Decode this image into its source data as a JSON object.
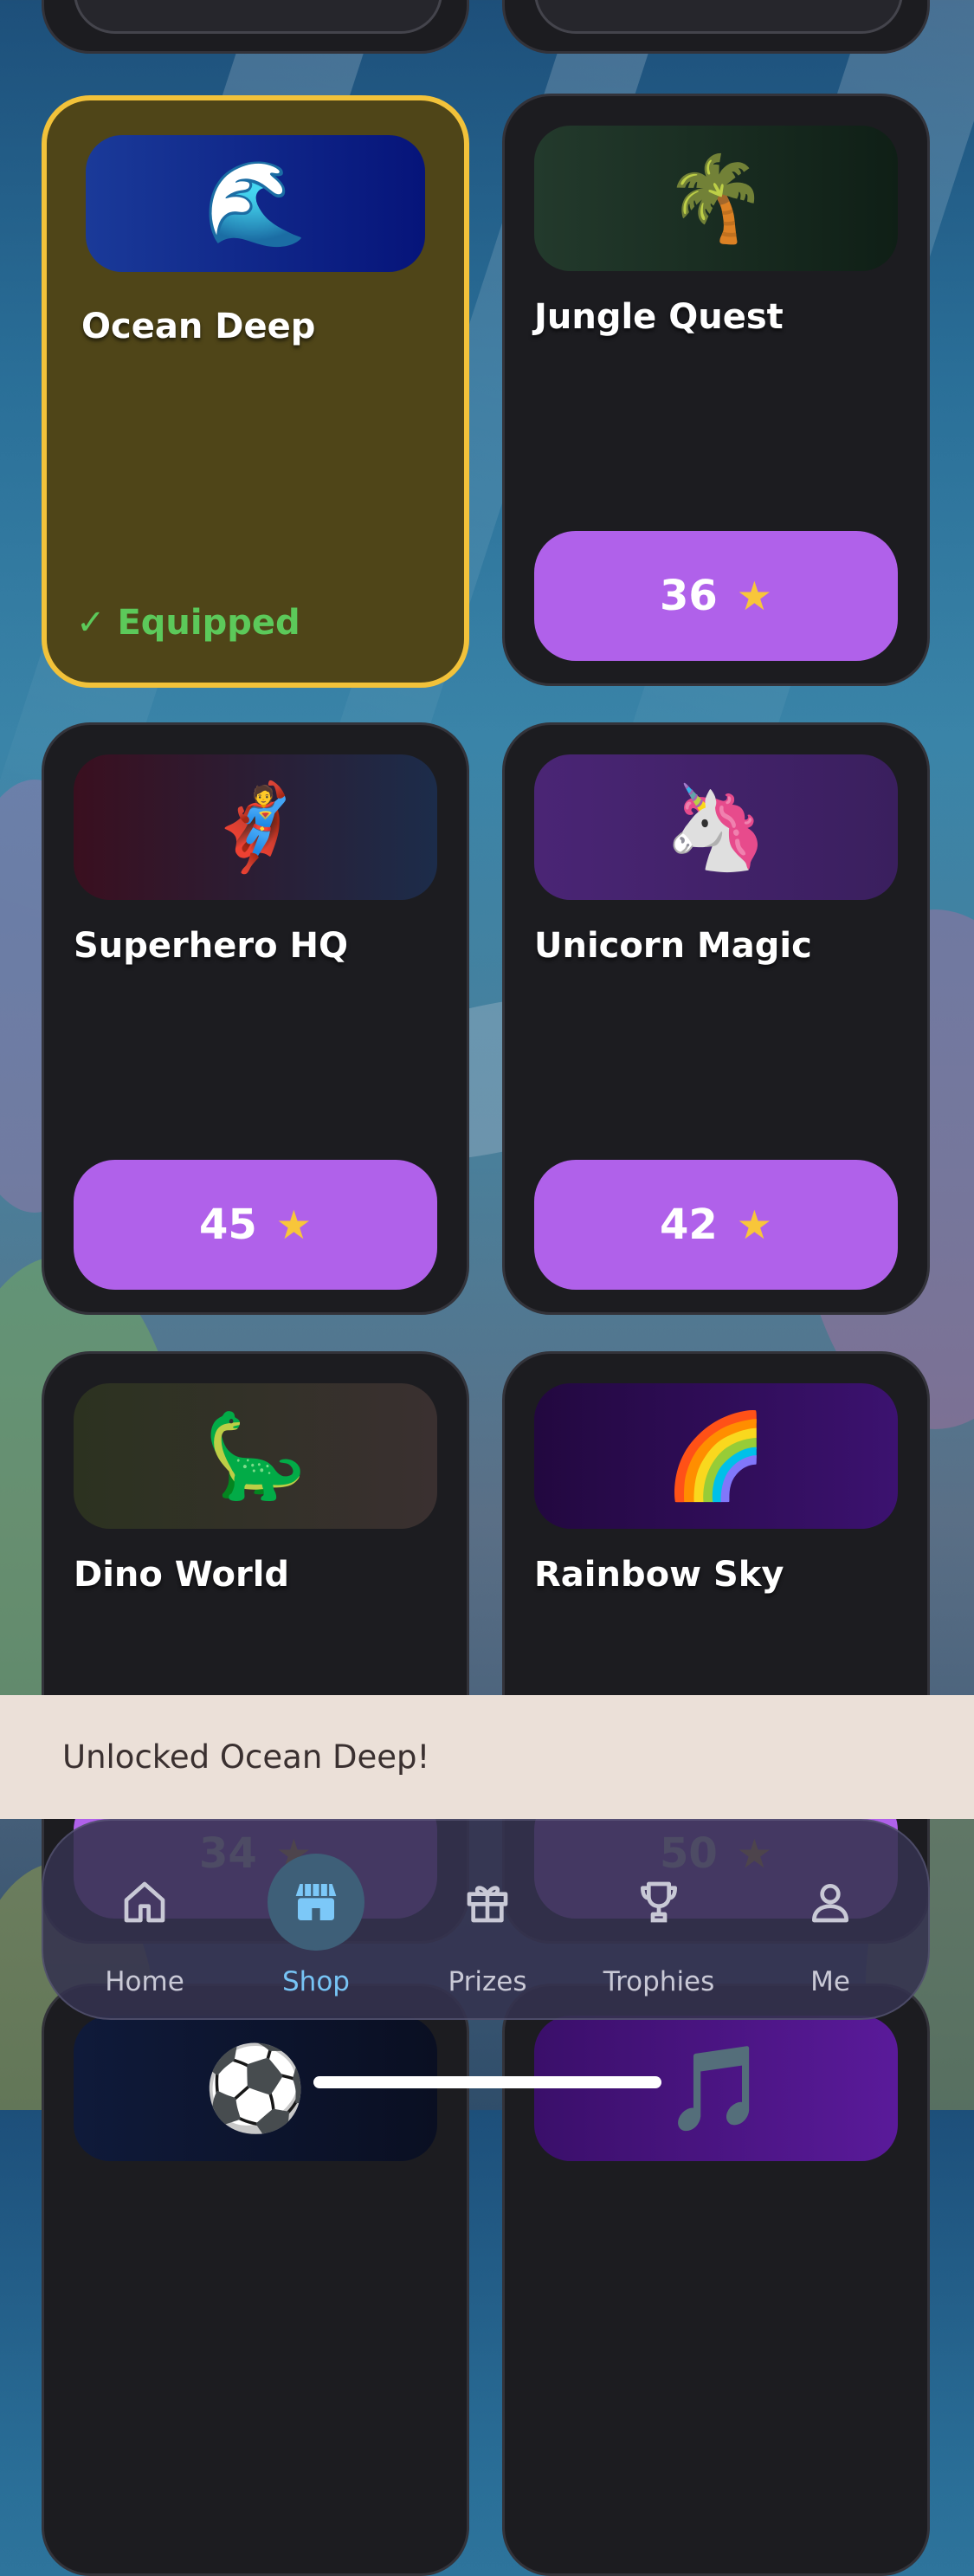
{
  "cards": [
    {
      "title": "Ocean Deep",
      "thumb_icon": "water-wave-icon",
      "thumb_glyph": "🌊",
      "status": "✓ Equipped",
      "price": null
    },
    {
      "title": "Jungle Quest",
      "thumb_icon": "palm-tree-icon",
      "thumb_glyph": "🌴",
      "price": "36",
      "price_icon": "star-icon"
    },
    {
      "title": "Superhero HQ",
      "thumb_icon": "superhero-icon",
      "thumb_glyph": "🦸",
      "price": "45",
      "price_icon": "star-icon"
    },
    {
      "title": "Unicorn Magic",
      "thumb_icon": "unicorn-icon",
      "thumb_glyph": "🦄",
      "price": "42",
      "price_icon": "star-icon"
    },
    {
      "title": "Dino World",
      "thumb_icon": "dinosaur-icon",
      "thumb_glyph": "🦕",
      "price": "34",
      "price_icon": "star-icon"
    },
    {
      "title": "Rainbow Sky",
      "thumb_icon": "rainbow-icon",
      "thumb_glyph": "🌈",
      "price": "50",
      "price_icon": "star-icon"
    },
    {
      "title": "",
      "thumb_icon": "soccer-ball-icon",
      "thumb_glyph": "⚽"
    },
    {
      "title": "",
      "thumb_icon": "music-note-icon",
      "thumb_glyph": "🎵"
    }
  ],
  "toast": {
    "message": "Unlocked Ocean Deep!"
  },
  "tabbar": {
    "tabs": [
      {
        "label": "Home",
        "icon": "house-icon"
      },
      {
        "label": "Shop",
        "icon": "store-icon",
        "active": true
      },
      {
        "label": "Prizes",
        "icon": "gift-icon"
      },
      {
        "label": "Trophies",
        "icon": "trophy-icon"
      },
      {
        "label": "Me",
        "icon": "person-icon"
      }
    ]
  },
  "colors": {
    "card_bg": "#1c1c20",
    "equipped_border": "#f2c23a",
    "price_button": "#b061ea",
    "star": "#f8c63a",
    "equipped_text": "#5cc95a",
    "active_tab": "#77c4f5"
  }
}
